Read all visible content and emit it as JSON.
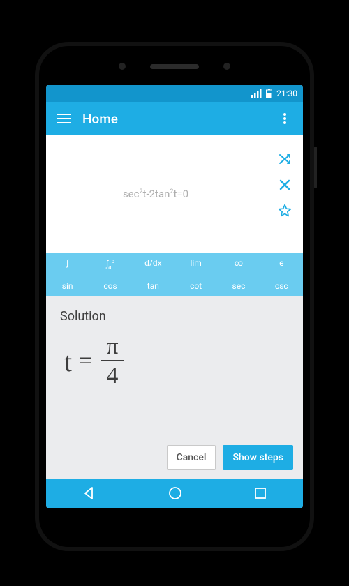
{
  "statusbar": {
    "time": "21:30"
  },
  "appbar": {
    "title": "Home"
  },
  "equation_input": {
    "raw": "sec²t-2tan²t=0",
    "parts": {
      "p1": "sec",
      "sup1": "2",
      "p2": "t-2tan",
      "sup2": "2",
      "p3": "t=0"
    }
  },
  "keyboard": {
    "row1": {
      "k0": "∫",
      "k1_base": "∫",
      "k1_sub": "a",
      "k1_sup": "b",
      "k2": "d/dx",
      "k3": "lim",
      "k4": "∞",
      "k5": "e"
    },
    "row2": {
      "k0": "sin",
      "k1": "cos",
      "k2": "tan",
      "k3": "cot",
      "k4": "sec",
      "k5": "csc"
    }
  },
  "solution": {
    "title": "Solution",
    "lhs_var": "t",
    "equals": "=",
    "numerator": "π",
    "denominator": "4"
  },
  "buttons": {
    "cancel": "Cancel",
    "show_steps": "Show steps"
  }
}
